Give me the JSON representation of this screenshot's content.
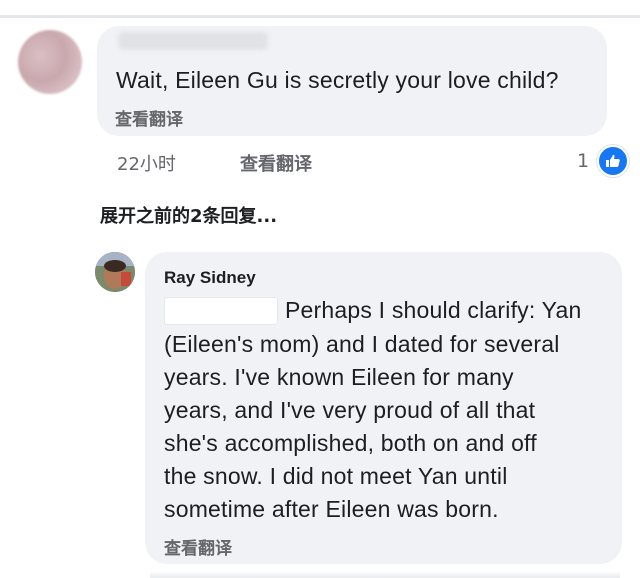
{
  "comment": {
    "text": "Wait, Eileen Gu is secretly your love child?",
    "translate_label": "查看翻译",
    "time": "22小时",
    "footer_translate": "查看翻译",
    "like_count": "1",
    "like_icon": "thumbs-up-icon",
    "like_color": "#1877f2"
  },
  "expand_replies": "展开之前的2条回复...",
  "reply": {
    "author": "Ray Sidney",
    "lines": [
      "Perhaps I should clarify: Yan",
      "(Eileen's mom) and I dated for several",
      "years. I've known Eileen for many",
      "years, and I've very proud of all that",
      "she's accomplished, both on and off",
      "the snow. I did not meet Yan until",
      "sometime after Eileen was born."
    ],
    "translate_label": "查看翻译"
  }
}
